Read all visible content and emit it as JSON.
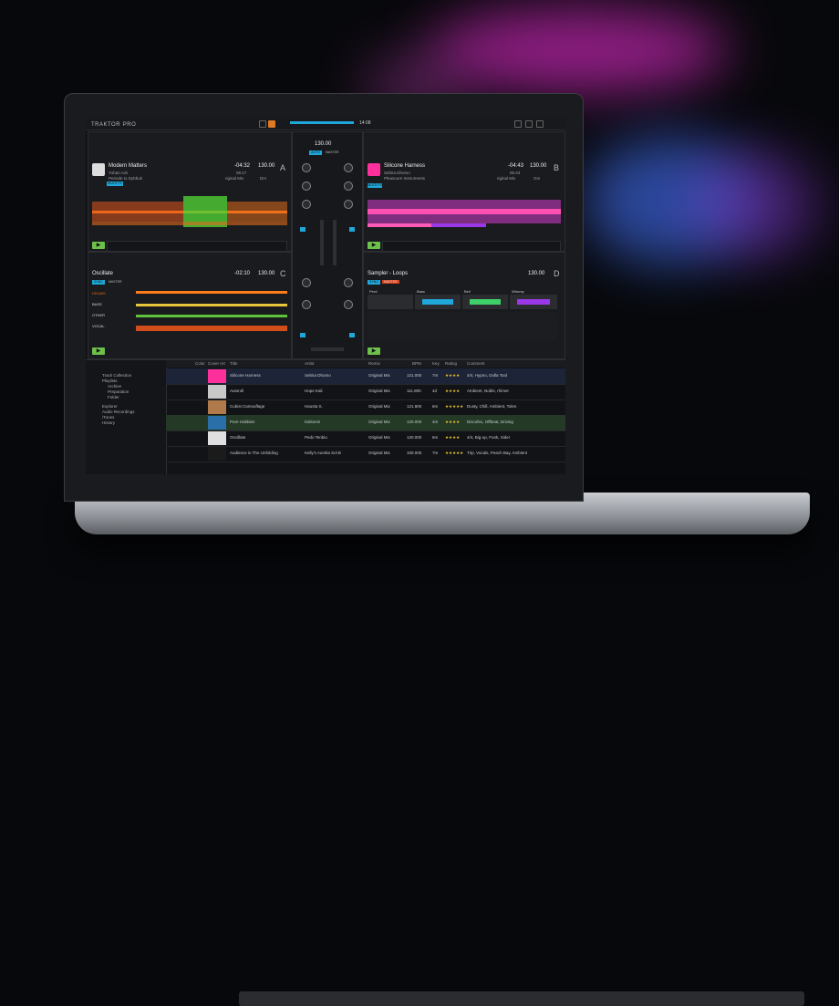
{
  "app": {
    "logo": "TRAKTOR",
    "logo_suffix": "PRO",
    "clock": "14:08"
  },
  "deck_a": {
    "title": "Modern Matters",
    "artist": "Yohan Aini",
    "label": "Periode to Dybbuk",
    "remain": "-04:32",
    "total": "06:17",
    "bpm": "130.00",
    "mix": "riginal Mix",
    "key": "Dm",
    "letter": "A",
    "mode": "MULTI FX"
  },
  "deck_b": {
    "title": "Silicone Harness",
    "artist": "Sebira Dhomo",
    "label": "Pleasoure Instruments",
    "remain": "-04:43",
    "total": "06:43",
    "bpm": "130.00",
    "mix": "riginal Mix",
    "key": "Gm",
    "letter": "B",
    "mode": "MULTI FX"
  },
  "deck_c": {
    "title": "Oscillate",
    "remain": "-02:10",
    "bpm": "130.00",
    "letter": "C",
    "sync": "SYNC",
    "master": "MASTER",
    "stems": [
      "DRUMS",
      "BASS",
      "OTHER",
      "VOCAL"
    ]
  },
  "deck_d": {
    "title": "Sampler - Loops",
    "bpm": "130.00",
    "letter": "D",
    "sync": "SYNC",
    "master": "MASTER",
    "slots": [
      "Perd",
      "Bass",
      "Bell",
      "Whump"
    ]
  },
  "mixer": {
    "bpm": "130.00",
    "master": "MASTER",
    "auto": "AUTO"
  },
  "library": {
    "tree": [
      "Track Collection",
      "Playlists",
      "Archive",
      "Preparation",
      "Folder",
      "Explorer",
      "Audio Recordings",
      "iTunes",
      "History"
    ],
    "headers": [
      "Color",
      "Cover Art",
      "Title",
      "Artist",
      "Remix",
      "BPM",
      "Key",
      "Rating",
      "Comment"
    ],
    "rows": [
      {
        "title": "Silicone Harness",
        "artist": "Sebira Dhomo",
        "remix": "Original Mix",
        "bpm": "121.000",
        "key": "7m",
        "rating": "★★★★",
        "comment": "4/4, Hypno, Dolla Tool"
      },
      {
        "title": "Autoroll",
        "artist": "Hope Kali",
        "remix": "Original Mix",
        "bpm": "111.800",
        "key": "4d",
        "rating": "★★★★",
        "comment": "Ambient, Noble, rhimer"
      },
      {
        "title": "Cubist Camouflage",
        "artist": "Hausta S.",
        "remix": "Original Mix",
        "bpm": "121.800",
        "key": "6m",
        "rating": "★★★★★",
        "comment": "Dusty, Chill, Ambient, Tolen"
      },
      {
        "title": "Pure Hobbies",
        "artist": "Kidsnein",
        "remix": "Original Mix",
        "bpm": "120.000",
        "key": "4m",
        "rating": "★★★★",
        "comment": "Discofex, Offbeat, Driving"
      },
      {
        "title": "Oscillate",
        "artist": "Pedo Tenbio",
        "remix": "Original Mix",
        "bpm": "120.000",
        "key": "6m",
        "rating": "★★★★",
        "comment": "4/4, Big-up, Funk, Sider"
      },
      {
        "title": "Audience in The Unfolding",
        "artist": "Kelly's Aurelia Sol B",
        "remix": "Original Mix",
        "bpm": "100.000",
        "key": "7m",
        "rating": "★★★★★",
        "comment": "Trip, Vocals, Peach Bay, Ambient"
      }
    ]
  }
}
